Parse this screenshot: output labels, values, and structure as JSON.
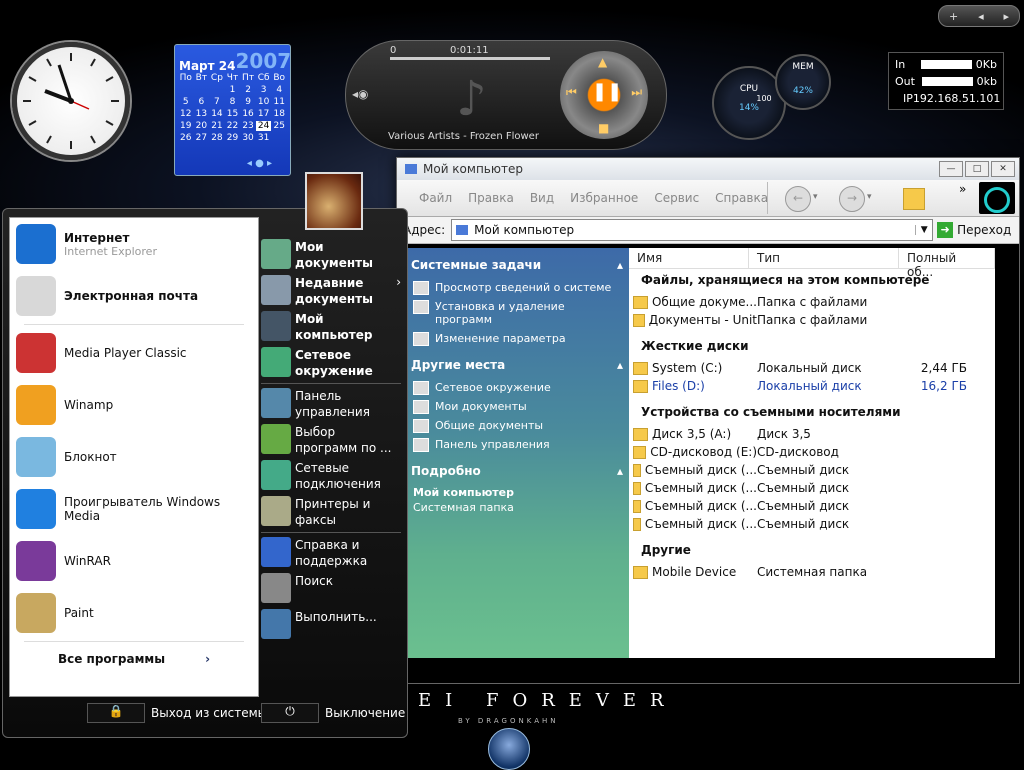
{
  "topbar": {
    "plus": "+",
    "prev": "◂",
    "next": "▸"
  },
  "calendar": {
    "month": "Март",
    "day": "24",
    "year": "2007",
    "weekdays": [
      "По",
      "Вт",
      "Ср",
      "Чт",
      "Пт",
      "Сб",
      "Во"
    ],
    "weeks": [
      [
        "",
        "",
        "",
        "1",
        "2",
        "3",
        "4"
      ],
      [
        "5",
        "6",
        "7",
        "8",
        "9",
        "10",
        "11"
      ],
      [
        "12",
        "13",
        "14",
        "15",
        "16",
        "17",
        "18"
      ],
      [
        "19",
        "20",
        "21",
        "22",
        "23",
        "24",
        "25"
      ],
      [
        "26",
        "27",
        "28",
        "29",
        "30",
        "31",
        ""
      ]
    ],
    "today": "24"
  },
  "player": {
    "position": "0",
    "time": "0:01:11",
    "track": "Various Artists - Frozen Flower"
  },
  "gauges": {
    "cpu_label": "CPU",
    "cpu_value": "14%",
    "cpu_scale": "100",
    "mem_label": "MEM",
    "mem_value": "42%"
  },
  "network": {
    "in_label": "In",
    "in_value": "0Kb",
    "out_label": "Out",
    "out_value": "0kb",
    "ip_label": "IP",
    "ip_value": "192.168.51.101"
  },
  "window": {
    "title": "Мой компьютер",
    "menu": [
      "Файл",
      "Правка",
      "Вид",
      "Избранное",
      "Сервис",
      "Справка"
    ],
    "overflow": "»",
    "address_label": "Адрес:",
    "address_value": "Мой компьютер",
    "go_label": "Переход",
    "left_pane": {
      "system_tasks_title": "Системные задачи",
      "system_tasks": [
        "Просмотр сведений о системе",
        "Установка и удаление программ",
        "Изменение параметра"
      ],
      "other_places_title": "Другие места",
      "other_places": [
        "Сетевое окружение",
        "Мои документы",
        "Общие документы",
        "Панель управления"
      ],
      "details_title": "Подробно",
      "details_name": "Мой компьютер",
      "details_type": "Системная папка"
    },
    "columns": [
      "Имя",
      "Тип",
      "Полный об..."
    ],
    "groups": {
      "files_title": "Файлы, хранящиеся на этом компьютере",
      "files": [
        {
          "name": "Общие докуме...",
          "type": "Папка с файлами",
          "size": ""
        },
        {
          "name": "Документы - Unit",
          "type": "Папка с файлами",
          "size": ""
        }
      ],
      "hdd_title": "Жесткие диски",
      "hdd": [
        {
          "name": "System (C:)",
          "type": "Локальный диск",
          "size": "2,44 ГБ"
        },
        {
          "name": "Files (D:)",
          "type": "Локальный диск",
          "size": "16,2 ГБ"
        }
      ],
      "removable_title": "Устройства со съемными носителями",
      "removable": [
        {
          "name": "Диск 3,5 (A:)",
          "type": "Диск 3,5"
        },
        {
          "name": "CD-дисковод (E:)",
          "type": "CD-дисковод"
        },
        {
          "name": "Съемный диск (...",
          "type": "Съемный диск"
        },
        {
          "name": "Съемный диск (...",
          "type": "Съемный диск"
        },
        {
          "name": "Съемный диск (...",
          "type": "Съемный диск"
        },
        {
          "name": "Съемный диск (...",
          "type": "Съемный диск"
        }
      ],
      "other_title": "Другие",
      "other": [
        {
          "name": "Mobile Device",
          "type": "Системная папка"
        }
      ]
    }
  },
  "start_menu": {
    "pinned": [
      {
        "label": "Интернет",
        "sub": "Internet Explorer",
        "bold": true
      },
      {
        "label": "Электронная почта",
        "sub": "",
        "bold": true
      }
    ],
    "recent": [
      "Media Player Classic",
      "Winamp",
      "Блокнот",
      "Проигрыватель Windows Media",
      "WinRAR",
      "Paint"
    ],
    "all_programs": "Все программы",
    "all_programs_arrow": "›",
    "right": [
      {
        "label": "Мои документы",
        "bold": true
      },
      {
        "label": "Недавние документы",
        "bold": true,
        "arrow": "›"
      },
      {
        "label": "Мой компьютер",
        "bold": true
      },
      {
        "label": "Сетевое окружение",
        "bold": true
      },
      {
        "label": "Панель управления",
        "bold": false
      },
      {
        "label": "Выбор программ по ...",
        "bold": false
      },
      {
        "label": "Сетевые подключения",
        "bold": false
      },
      {
        "label": "Принтеры и факсы",
        "bold": false
      },
      {
        "label": "Справка и поддержка",
        "bold": false
      },
      {
        "label": "Поиск",
        "bold": false
      },
      {
        "label": "Выполнить...",
        "bold": false
      }
    ],
    "logoff": "Выход из системы",
    "shutdown": "Выключение"
  },
  "branding": {
    "title": "EI FOREVER",
    "subtitle": "BY DRAGONKAHN"
  },
  "colors": {
    "accent_blue": "#1a3fa8",
    "pane_top": "#3d6aa8",
    "pane_bottom": "#6bc08f",
    "calendar": "#2a5ae0"
  }
}
